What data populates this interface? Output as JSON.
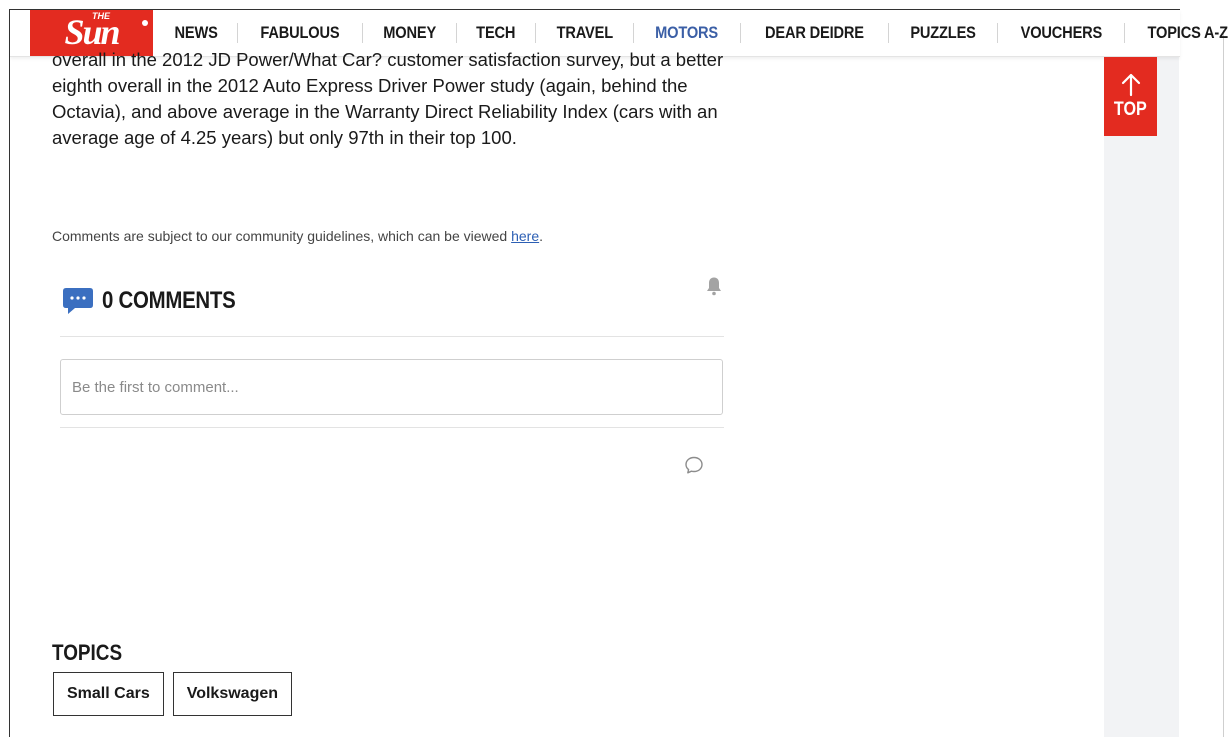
{
  "brand": {
    "logo_small": "THE",
    "logo_main": "Sun",
    "colors": {
      "brand_red": "#e32b20",
      "active_nav": "#3b5fa6",
      "link": "#2c5fb4",
      "comment_icon": "#3b6fc0"
    }
  },
  "nav": {
    "items": [
      {
        "label": "NEWS"
      },
      {
        "label": "FABULOUS"
      },
      {
        "label": "MONEY"
      },
      {
        "label": "TECH"
      },
      {
        "label": "TRAVEL"
      },
      {
        "label": "MOTORS",
        "active": true
      },
      {
        "label": "DEAR DEIDRE"
      },
      {
        "label": "PUZZLES"
      },
      {
        "label": "VOUCHERS"
      },
      {
        "label": "TOPICS A-Z"
      }
    ]
  },
  "article": {
    "paragraph": "overall in the 2012 JD Power/What Car? customer satisfaction survey, but a better eighth overall in the 2012 Auto Express Driver Power study (again, behind the Octavia), and above average in the Warranty Direct Reliability Index (cars with an average age of 4.25 years) but only 97th in their top 100."
  },
  "comments": {
    "guidelines_text": "Comments are subject to our community guidelines, which can be viewed ",
    "guidelines_link": "here",
    "guidelines_end": ".",
    "count_title": "0 COMMENTS",
    "input_placeholder": "Be the first to comment...",
    "icons": {
      "header": "comment-bubble-icon",
      "notify": "bell-icon",
      "reply": "chat-icon"
    }
  },
  "topics": {
    "title": "TOPICS",
    "tags": [
      {
        "label": "Small Cars"
      },
      {
        "label": "Volkswagen"
      }
    ]
  },
  "back_to_top": {
    "label": "TOP",
    "icon": "arrow-up-icon"
  }
}
